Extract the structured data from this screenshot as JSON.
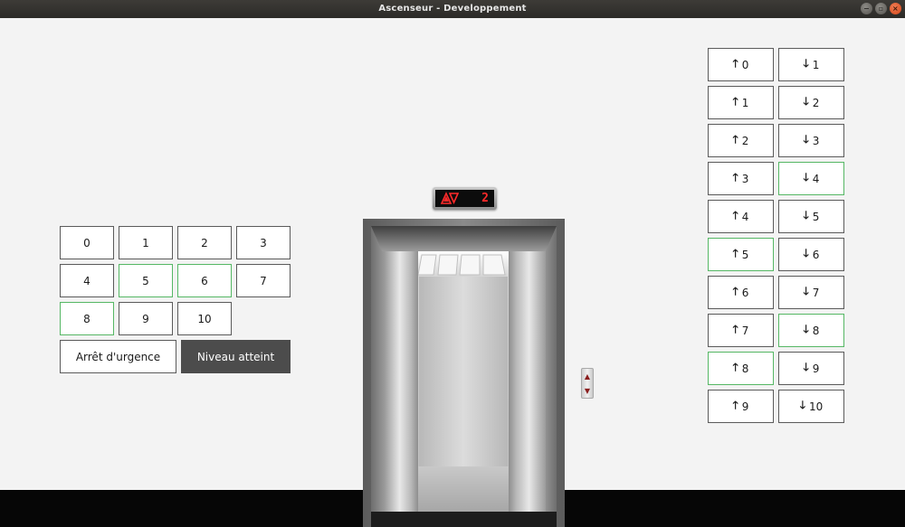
{
  "window": {
    "title": "Ascenseur - Developpement",
    "controls": {
      "minimize": "−",
      "maximize": "▫",
      "close": "×"
    }
  },
  "cabin_keypad": {
    "floors": [
      {
        "label": "0",
        "lit": false
      },
      {
        "label": "1",
        "lit": false
      },
      {
        "label": "2",
        "lit": false
      },
      {
        "label": "3",
        "lit": false
      },
      {
        "label": "4",
        "lit": false
      },
      {
        "label": "5",
        "lit": true
      },
      {
        "label": "6",
        "lit": true
      },
      {
        "label": "7",
        "lit": false
      },
      {
        "label": "8",
        "lit": true
      },
      {
        "label": "9",
        "lit": false
      },
      {
        "label": "10",
        "lit": false
      }
    ],
    "emergency_label": "Arrêt d'urgence",
    "level_reached_label": "Niveau atteint"
  },
  "indicator": {
    "current_floor": "2",
    "color": "#ff2a2a"
  },
  "call_panel": {
    "up": "▲",
    "down": "▼"
  },
  "hall_buttons": {
    "up_arrow": "🡑",
    "down_arrow": "🡓",
    "up": [
      {
        "label": "0",
        "lit": false
      },
      {
        "label": "1",
        "lit": false
      },
      {
        "label": "2",
        "lit": false
      },
      {
        "label": "3",
        "lit": false
      },
      {
        "label": "4",
        "lit": false
      },
      {
        "label": "5",
        "lit": true
      },
      {
        "label": "6",
        "lit": false
      },
      {
        "label": "7",
        "lit": false
      },
      {
        "label": "8",
        "lit": true
      },
      {
        "label": "9",
        "lit": false
      }
    ],
    "down": [
      {
        "label": "1",
        "lit": false
      },
      {
        "label": "2",
        "lit": false
      },
      {
        "label": "3",
        "lit": false
      },
      {
        "label": "4",
        "lit": true
      },
      {
        "label": "5",
        "lit": false
      },
      {
        "label": "6",
        "lit": false
      },
      {
        "label": "7",
        "lit": false
      },
      {
        "label": "8",
        "lit": true
      },
      {
        "label": "9",
        "lit": false
      },
      {
        "label": "10",
        "lit": false
      }
    ]
  },
  "colors": {
    "lit_border": "#55b764",
    "dark_button": "#4c4c4c"
  }
}
